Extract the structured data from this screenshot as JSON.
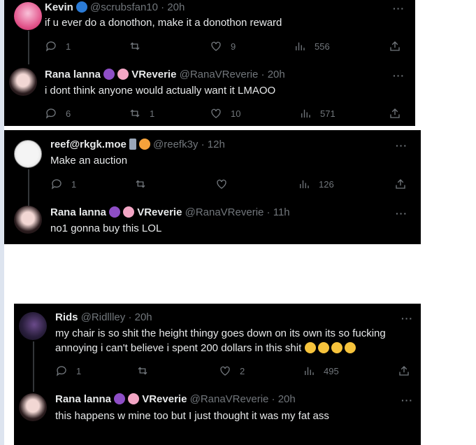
{
  "panels": [
    {
      "tweets": [
        {
          "name": "Kevin",
          "handle": "@scrubsfan10",
          "time": "20h",
          "text": "if u ever do a donothon, make it a donothon reward",
          "replies": "1",
          "reposts": "",
          "likes": "9",
          "views": "556"
        },
        {
          "name": "Rana lanna",
          "name2": "VReverie",
          "handle": "@RanaVReverie",
          "time": "20h",
          "text": "i dont think anyone would actually want it LMAOO",
          "replies": "6",
          "reposts": "1",
          "likes": "10",
          "views": "571"
        }
      ]
    },
    {
      "tweets": [
        {
          "name": "reef@rkgk.moe",
          "handle": "@reefk3y",
          "time": "12h",
          "text": "Make an auction",
          "replies": "1",
          "reposts": "",
          "likes": "",
          "views": "126"
        },
        {
          "name": "Rana lanna",
          "name2": "VReverie",
          "handle": "@RanaVReverie",
          "time": "11h",
          "text": "no1 gonna buy this LOL"
        }
      ]
    },
    {
      "tweets": [
        {
          "name": "Rids",
          "handle": "@Ridllley",
          "time": "20h",
          "text_line1": "my chair is so shit the height thingy goes down on its own its so fucking",
          "text_line2": "annoying i can't believe i spent 200 dollars in this shit",
          "replies": "1",
          "reposts": "",
          "likes": "2",
          "views": "495"
        },
        {
          "name": "Rana lanna",
          "name2": "VReverie",
          "handle": "@RanaVReverie",
          "time": "20h",
          "text": "this happens w mine too but I just thought it was my fat ass"
        }
      ]
    }
  ],
  "sep": "·",
  "more": "···",
  "colors": {
    "bg": "#000000",
    "text": "#e7e9ea",
    "muted": "#71767b",
    "thread": "#333639"
  },
  "icons": [
    "reply-icon",
    "repost-icon",
    "like-icon",
    "views-icon",
    "share-icon",
    "more-icon"
  ]
}
